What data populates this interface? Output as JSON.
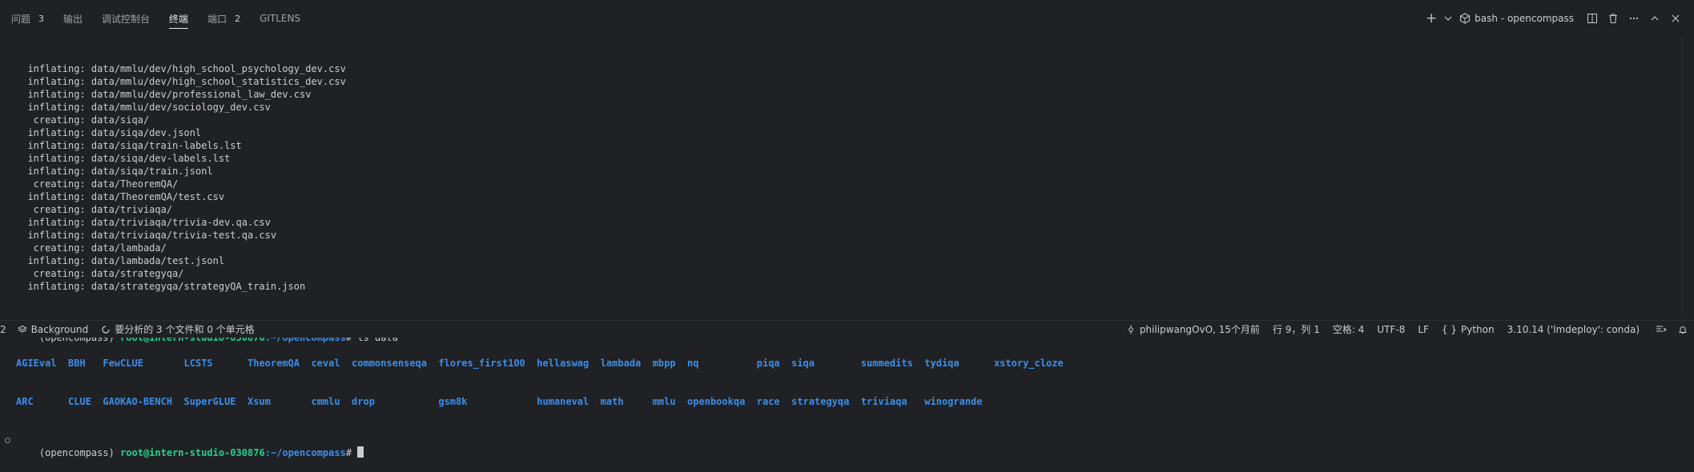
{
  "tabs": [
    {
      "label": "问题",
      "badge": "3",
      "active": false
    },
    {
      "label": "输出",
      "badge": "",
      "active": false
    },
    {
      "label": "调试控制台",
      "badge": "",
      "active": false
    },
    {
      "label": "终端",
      "badge": "",
      "active": true
    },
    {
      "label": "端口",
      "badge": "2",
      "active": false
    },
    {
      "label": "GITLENS",
      "badge": "",
      "active": false
    }
  ],
  "toolbar": {
    "new_terminal": "+",
    "terminal_title": "bash - opencompass"
  },
  "terminal": {
    "log_lines": [
      "  inflating: data/mmlu/dev/high_school_psychology_dev.csv",
      "  inflating: data/mmlu/dev/high_school_statistics_dev.csv",
      "  inflating: data/mmlu/dev/professional_law_dev.csv",
      "  inflating: data/mmlu/dev/sociology_dev.csv",
      "   creating: data/siqa/",
      "  inflating: data/siqa/dev.jsonl",
      "  inflating: data/siqa/train-labels.lst",
      "  inflating: data/siqa/dev-labels.lst",
      "  inflating: data/siqa/train.jsonl",
      "   creating: data/TheoremQA/",
      "  inflating: data/TheoremQA/test.csv",
      "   creating: data/triviaqa/",
      "  inflating: data/triviaqa/trivia-dev.qa.csv",
      "  inflating: data/triviaqa/trivia-test.qa.csv",
      "   creating: data/lambada/",
      "  inflating: data/lambada/test.jsonl",
      "   creating: data/strategyqa/",
      "  inflating: data/strategyqa/strategyQA_train.json"
    ],
    "prompt_env": "(opencompass) ",
    "prompt_user": "root@intern-studio-030876",
    "prompt_path": ":~/opencompass",
    "prompt_symbol": "# ",
    "command": "ls data",
    "ls_row1": "AGIEval  BBH   FewCLUE       LCSTS      TheoremQA  ceval  commonsenseqa  flores_first100  hellaswag  lambada  mbpp  nq          piqa  siqa        summedits  tydiqa      xstory_cloze",
    "ls_row2": "ARC      CLUE  GAOKAO-BENCH  SuperGLUE  Xsum       cmmlu  drop           gsm8k            humaneval  math     mmlu  openbookqa  race  strategyqa  triviaqa   winogrande"
  },
  "status": {
    "left_number": "2",
    "background": "Background",
    "analysis": "要分析的 3 个文件和 0 个单元格",
    "git_author": "philipwangOvO, 15个月前",
    "position": "行 9，列 1",
    "spaces": "空格: 4",
    "encoding": "UTF-8",
    "eol": "LF",
    "lang_braces": "{ }",
    "language": "Python",
    "interpreter": "3.10.14 ('lmdeploy': conda)"
  },
  "colors": {
    "background": "#1f2125",
    "prompt_user": "#23d18b",
    "prompt_path": "#3b8eea",
    "dir_listing": "#3b8eea",
    "decoration_success": "#3794ff"
  }
}
